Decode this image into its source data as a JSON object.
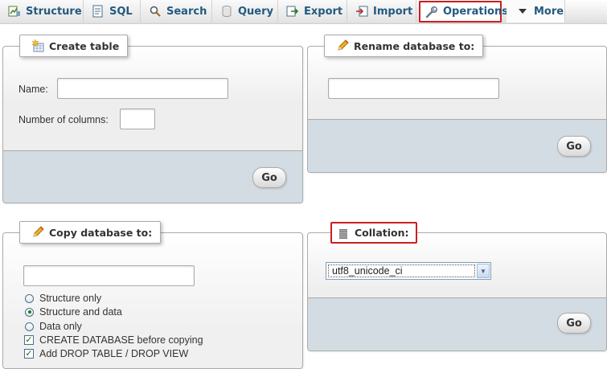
{
  "tabs": [
    {
      "label": "Structure",
      "icon": "structure-icon"
    },
    {
      "label": "SQL",
      "icon": "sql-icon"
    },
    {
      "label": "Search",
      "icon": "search-icon"
    },
    {
      "label": "Query",
      "icon": "query-icon"
    },
    {
      "label": "Export",
      "icon": "export-icon"
    },
    {
      "label": "Import",
      "icon": "import-icon"
    },
    {
      "label": "Operations",
      "icon": "wrench-icon",
      "active": true
    },
    {
      "label": "More",
      "icon": "triangle-down-icon"
    }
  ],
  "create_table": {
    "legend": "Create table",
    "name_label": "Name:",
    "name_value": "",
    "columns_label": "Number of columns:",
    "columns_value": "",
    "go_label": "Go"
  },
  "rename_db": {
    "legend": "Rename database to:",
    "value": "",
    "go_label": "Go"
  },
  "copy_db": {
    "legend": "Copy database to:",
    "value": "",
    "options": [
      {
        "label": "Structure only",
        "type": "radio",
        "checked": false
      },
      {
        "label": "Structure and data",
        "type": "radio",
        "checked": true
      },
      {
        "label": "Data only",
        "type": "radio",
        "checked": false
      },
      {
        "label": "CREATE DATABASE before copying",
        "type": "checkbox",
        "checked": true
      },
      {
        "label": "Add DROP TABLE / DROP VIEW",
        "type": "checkbox",
        "checked": true
      }
    ]
  },
  "collation": {
    "legend": "Collation:",
    "selected": "utf8_unicode_ci",
    "go_label": "Go"
  },
  "colors": {
    "accent_text": "#235a81",
    "highlight_border": "#cc1f1f",
    "footer_bg": "#d3dce3"
  }
}
